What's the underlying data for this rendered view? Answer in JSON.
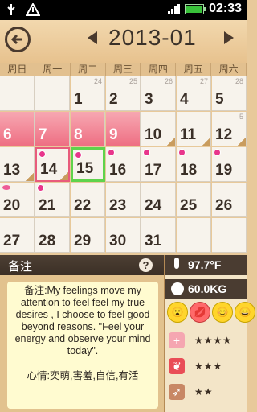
{
  "status_bar": {
    "time": "02:33"
  },
  "header": {
    "month": "2013-01"
  },
  "weekdays": [
    "周日",
    "周一",
    "周二",
    "周三",
    "周四",
    "周五",
    "周六"
  ],
  "calendar": {
    "weeks": [
      [
        {
          "day": "",
          "small": ""
        },
        {
          "day": "",
          "small": ""
        },
        {
          "day": "1",
          "small": "24"
        },
        {
          "day": "2",
          "small": ""
        },
        {
          "day": "3",
          "small": ""
        },
        {
          "day": "4",
          "small": ""
        },
        {
          "day": "5",
          "small": ""
        }
      ],
      [
        {
          "day": "6",
          "small": ""
        },
        {
          "day": "7",
          "small": ""
        },
        {
          "day": "8",
          "small": ""
        },
        {
          "day": "9",
          "small": ""
        },
        {
          "day": "10",
          "small": ""
        },
        {
          "day": "11",
          "small": ""
        },
        {
          "day": "12",
          "small": ""
        }
      ],
      [
        {
          "day": "13",
          "small": ""
        },
        {
          "day": "14",
          "small": ""
        },
        {
          "day": "15",
          "small": ""
        },
        {
          "day": "16",
          "small": ""
        },
        {
          "day": "17",
          "small": ""
        },
        {
          "day": "18",
          "small": ""
        },
        {
          "day": "19",
          "small": ""
        }
      ],
      [
        {
          "day": "20",
          "small": ""
        },
        {
          "day": "21",
          "small": ""
        },
        {
          "day": "22",
          "small": ""
        },
        {
          "day": "23",
          "small": ""
        },
        {
          "day": "24",
          "small": ""
        },
        {
          "day": "25",
          "small": ""
        },
        {
          "day": "26",
          "small": ""
        }
      ],
      [
        {
          "day": "27",
          "small": ""
        },
        {
          "day": "28",
          "small": ""
        },
        {
          "day": "29",
          "small": ""
        },
        {
          "day": "30",
          "small": ""
        },
        {
          "day": "31",
          "small": ""
        },
        {
          "day": "",
          "small": ""
        },
        {
          "day": "",
          "small": ""
        }
      ]
    ],
    "small_labels": [
      [
        "",
        "",
        "24",
        "25",
        "26",
        "27",
        "28"
      ],
      [
        "",
        "",
        "",
        "",
        "",
        "",
        "5"
      ],
      [
        "",
        "",
        "",
        "",
        "",
        "",
        ""
      ],
      [
        "",
        "",
        "",
        "",
        "",
        "",
        ""
      ],
      [
        "",
        "",
        "",
        "",
        "",
        "",
        ""
      ]
    ]
  },
  "notes": {
    "title": "备注",
    "text": "备注:My feelings move my attention to feel feel my true desires , I choose to feel good beyond reasons. \"Feel your energy and observe your mind today\".",
    "mood": "心情:奕萌,害羞,自信,有活"
  },
  "stats": {
    "temperature": "97.7°F",
    "weight": "60.0KG",
    "ratings": [
      "★★★★",
      "★★★",
      "★★"
    ]
  }
}
